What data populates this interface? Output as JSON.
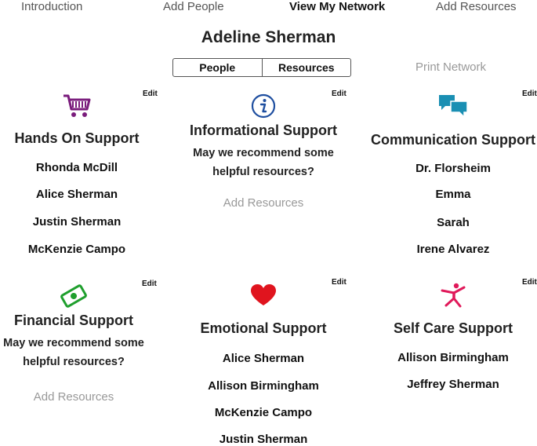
{
  "nav": {
    "items": [
      {
        "label": "Introduction"
      },
      {
        "label": "Add People"
      },
      {
        "label": "View My Network"
      },
      {
        "label": "Add Resources"
      }
    ]
  },
  "person_name": "Adeline Sherman",
  "view_toggle": {
    "people": "People",
    "resources": "Resources"
  },
  "print_network": "Print Network",
  "edit_label": "Edit",
  "colors": {
    "purple": "#7a1c7c",
    "blue": "#1f4fa0",
    "teal": "#1a8fb3",
    "green": "#1f9f2d",
    "red": "#e0141e",
    "pink": "#e0195a"
  },
  "cards": {
    "hands_on": {
      "title": "Hands On Support",
      "icon": "shopping-cart-icon",
      "people": [
        "Rhonda McDill",
        "Alice Sherman",
        "Justin Sherman",
        "McKenzie Campo"
      ]
    },
    "informational": {
      "title": "Informational Support",
      "icon": "info-icon",
      "recommend": "May we recommend some helpful resources?",
      "add": "Add Resources"
    },
    "communication": {
      "title": "Communication Support",
      "icon": "chat-bubbles-icon",
      "people": [
        "Dr. Florsheim",
        "Emma",
        "Sarah",
        "Irene Alvarez"
      ]
    },
    "financial": {
      "title": "Financial Support",
      "icon": "money-icon",
      "recommend": "May we recommend some helpful resources?",
      "add": "Add Resources"
    },
    "emotional": {
      "title": "Emotional Support",
      "icon": "heart-icon",
      "people": [
        "Alice Sherman",
        "Allison Birmingham",
        "McKenzie Campo",
        "Justin Sherman"
      ]
    },
    "self_care": {
      "title": "Self Care Support",
      "icon": "yoga-pose-icon",
      "people": [
        "Allison Birmingham",
        "Jeffrey Sherman"
      ]
    }
  }
}
